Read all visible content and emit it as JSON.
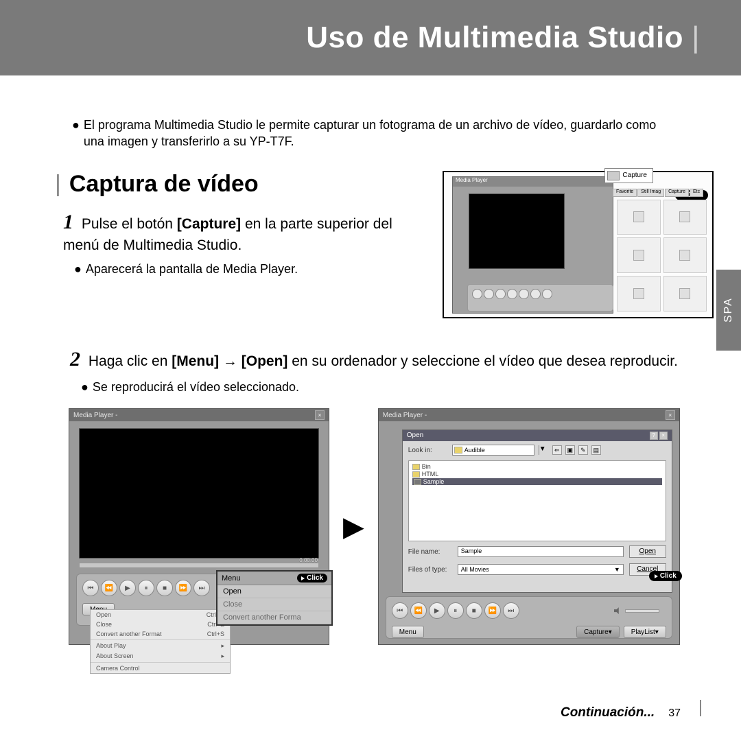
{
  "header": {
    "title": "Uso de Multimedia Studio"
  },
  "intro": "El programa Multimedia Studio le permite capturar un fotograma de un archivo de vídeo, guardarlo como una imagen y transferirlo a su YP-T7F.",
  "section": {
    "heading": "Captura de vídeo"
  },
  "step1": {
    "num": "1",
    "text_a": "Pulse el botón ",
    "bold": "[Capture]",
    "text_b": " en la parte superior del menú de Multimedia Studio.",
    "sub": "Aparecerá la pantalla de Media Player."
  },
  "thumb1": {
    "title": "Media Player",
    "capture_label": "Capture",
    "click": "Click",
    "tabs": [
      "Favorite",
      "Still Imag",
      "Capture",
      "Etc"
    ]
  },
  "step2": {
    "num": "2",
    "text_a": "Haga clic en ",
    "b1": "[Menu]",
    "arrow": " → ",
    "b2": "[Open]",
    "text_b": " en su ordenador y seleccione el vídeo que desea reproducir.",
    "sub": "Se reproducirá el vídeo seleccionado."
  },
  "mp_left": {
    "title": "Media Player -",
    "time": "0:00:00",
    "menu_btn": "Menu",
    "menu_items": {
      "head": "Menu",
      "open": "Open",
      "close": "Close",
      "convert": "Convert another Forma"
    },
    "dropdown": [
      {
        "l": "Open",
        "r": "Ctrl+O"
      },
      {
        "l": "Close",
        "r": "Ctrl+Z"
      },
      {
        "l": "Convert another Format",
        "r": "Ctrl+S"
      },
      {
        "l": "About Play",
        "r": "▸"
      },
      {
        "l": "About Screen",
        "r": "▸"
      },
      {
        "l": "Camera Control",
        "r": ""
      }
    ],
    "click": "Click"
  },
  "mp_right": {
    "title": "Media Player -",
    "dialog": {
      "title": "Open",
      "lookin": "Look in:",
      "folder": "Audible",
      "files": [
        "Bin",
        "HTML",
        "Sample"
      ],
      "filename_l": "File name:",
      "filename_v": "Sample",
      "filetype_l": "Files of type:",
      "filetype_v": "All Movies",
      "open": "Open",
      "cancel": "Cancel"
    },
    "menu_btn": "Menu",
    "capture_btn": "Capture",
    "playlist_btn": "PlayList",
    "click": "Click"
  },
  "tab": "SPA",
  "footer": {
    "cont": "Continuación...",
    "page": "37"
  }
}
